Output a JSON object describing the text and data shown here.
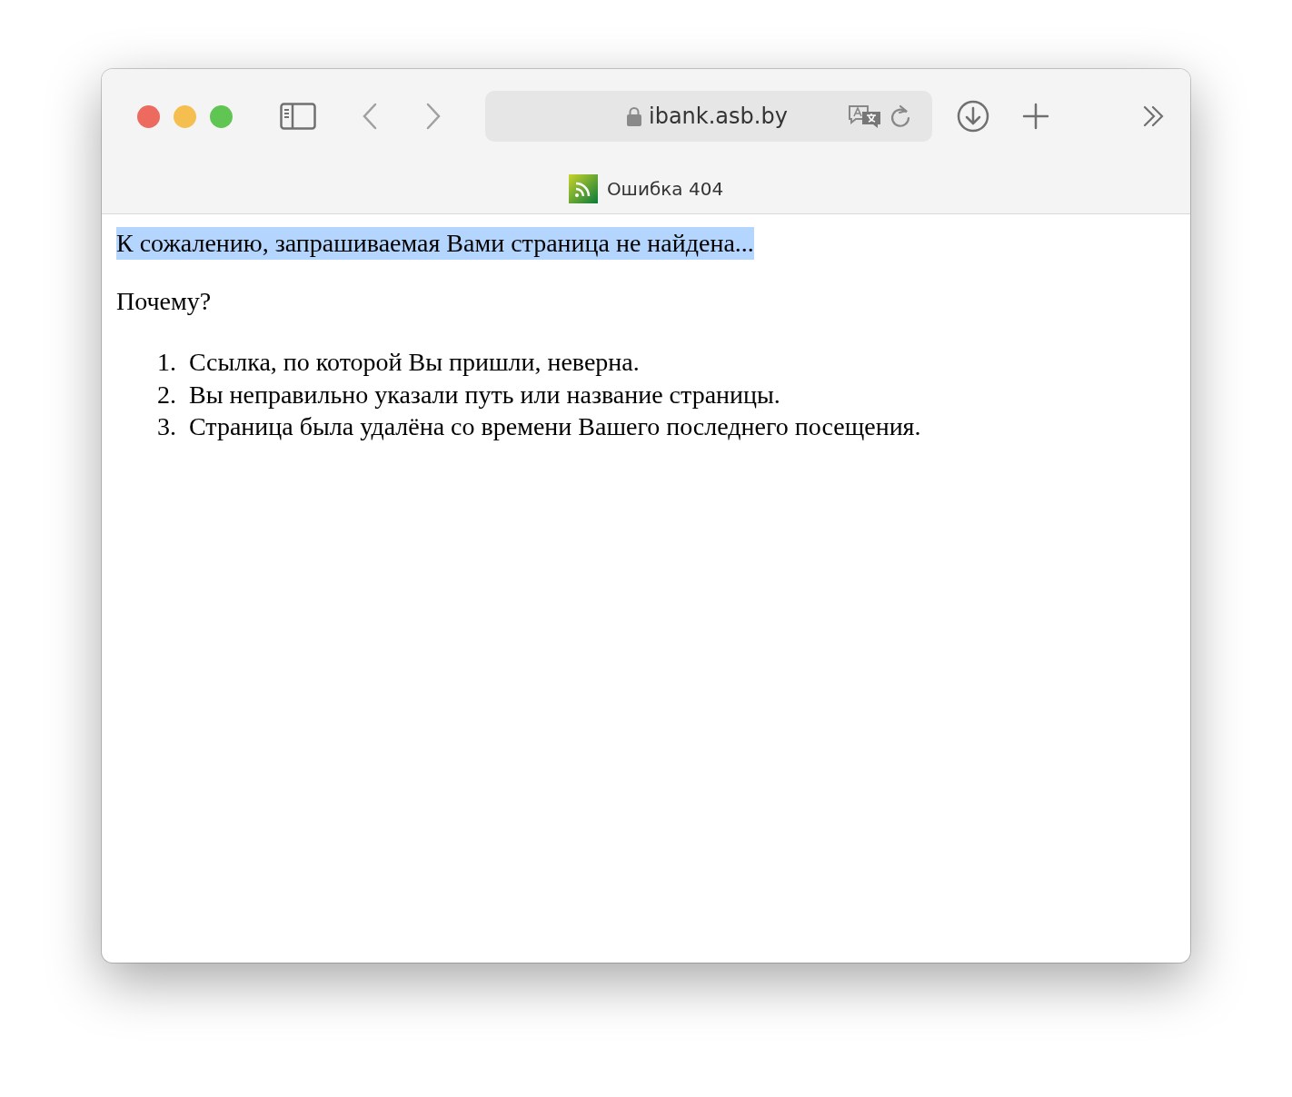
{
  "browser": {
    "url": "ibank.asb.by",
    "tab_title": "Ошибка 404"
  },
  "page": {
    "heading": {
      "text": "К сожалению, запрашиваемая Вами страница не найдена...",
      "highlighted": true
    },
    "question": "Почему?",
    "reasons": [
      {
        "number": "1.",
        "text": "Ссылка, по которой Вы пришли, неверна."
      },
      {
        "number": "2.",
        "text": "Вы неправильно указали путь или название страницы."
      },
      {
        "number": "3.",
        "text": "Страница была удалёна со времени Вашего последнего посещения."
      }
    ]
  }
}
